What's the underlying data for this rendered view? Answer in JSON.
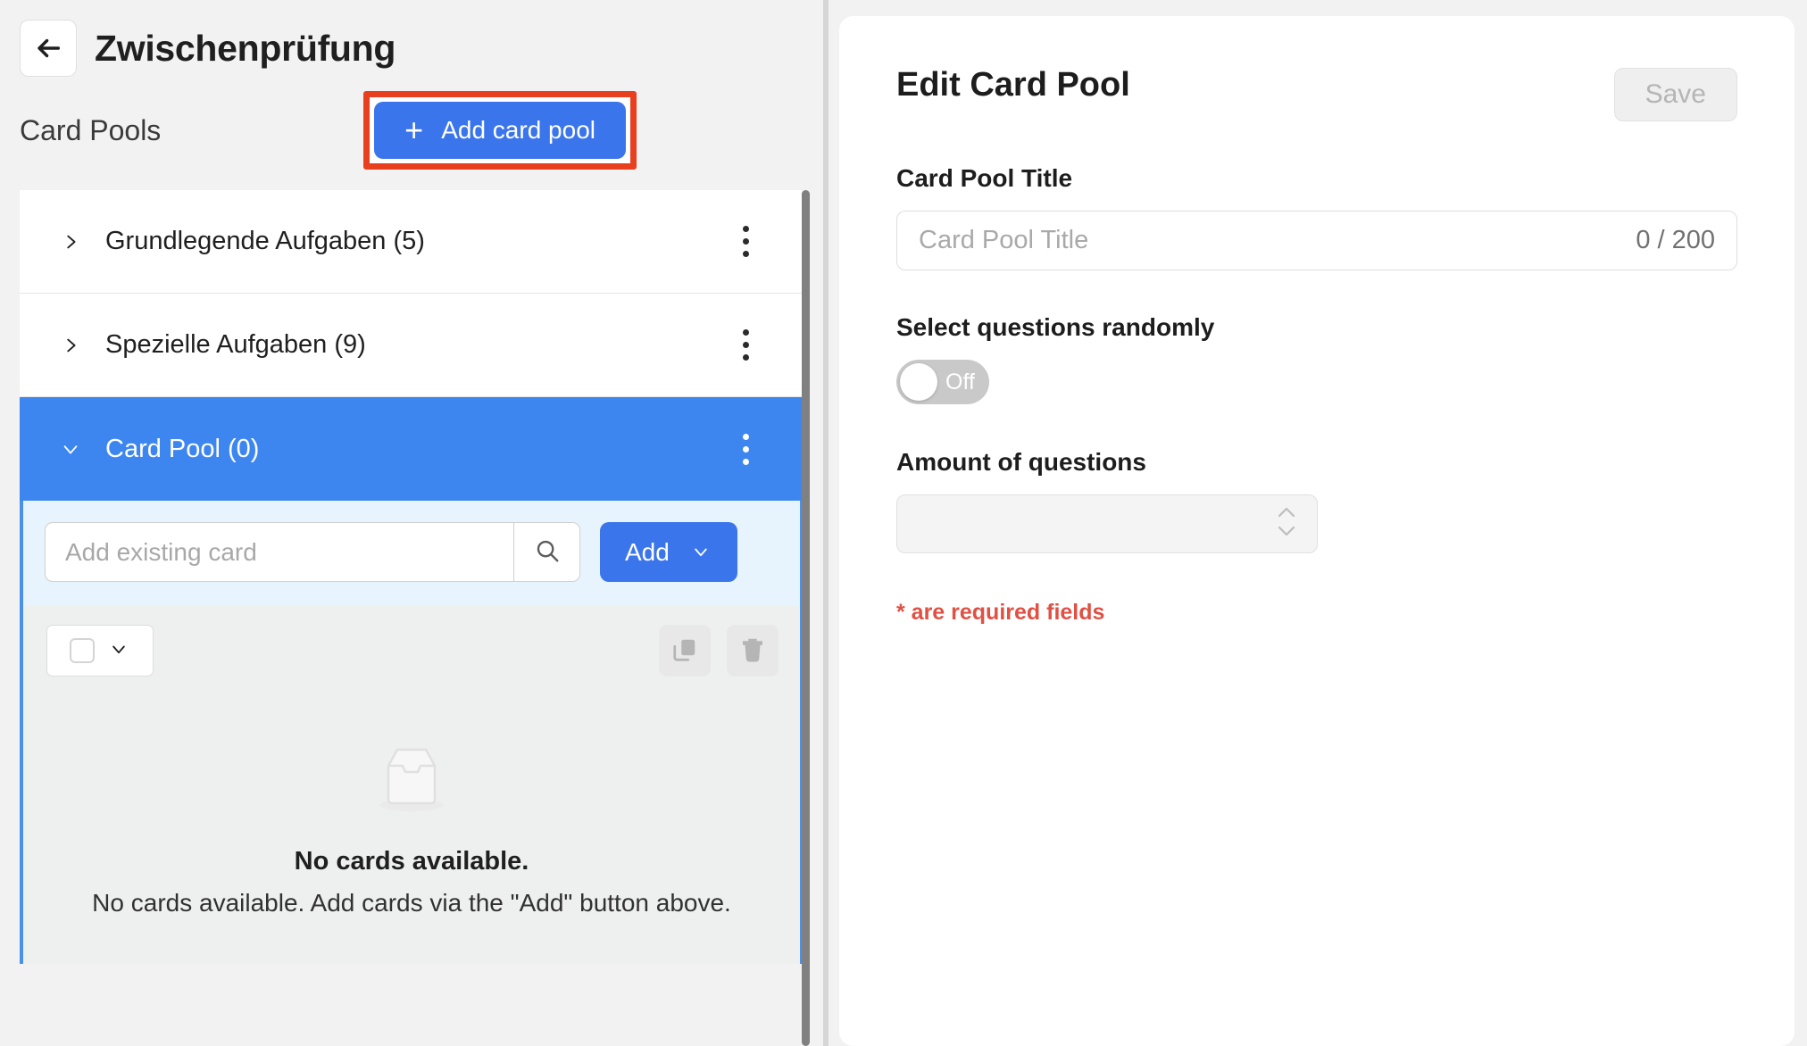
{
  "header": {
    "back_icon": "arrow-left-icon",
    "title": "Zwischenprüfung",
    "section_label": "Card Pools",
    "add_pool_label": "Add card pool",
    "add_pool_plus": "+"
  },
  "colors": {
    "accent_blue": "#3b75ec",
    "selected_row_blue": "#3d86f0",
    "expanded_border_blue": "#4a90e8",
    "search_zone_blue": "#e7f3fd",
    "highlight_red": "#e8401f",
    "required_red": "#e05043",
    "page_bg": "#f2f2f2",
    "scrollbar_grey": "#808080"
  },
  "pool_list": {
    "items": [
      {
        "name": "Grundlegende Aufgaben (5)",
        "expanded": false,
        "selected": false,
        "chevron": "chevron-right-icon"
      },
      {
        "name": "Spezielle Aufgaben (9)",
        "expanded": false,
        "selected": false,
        "chevron": "chevron-right-icon"
      },
      {
        "name": "Card Pool (0)",
        "expanded": true,
        "selected": true,
        "chevron": "chevron-down-icon"
      }
    ]
  },
  "expanded_panel": {
    "search_placeholder": "Add existing card",
    "search_value": "",
    "search_icon": "magnifier-icon",
    "add_button_label": "Add",
    "add_button_chevron": "chevron-down-icon",
    "select_all_checkbox": "checkbox-unchecked-icon",
    "select_all_chevron": "chevron-down-icon",
    "duplicate_icon": "copy-icon",
    "delete_icon": "trash-icon",
    "empty_icon": "empty-inbox-icon",
    "empty_title": "No cards available.",
    "empty_description": "No cards available. Add cards via the \"Add\" button above."
  },
  "edit_panel": {
    "title": "Edit Card Pool",
    "save_label": "Save",
    "card_pool_title_label": "Card Pool Title",
    "card_pool_title_placeholder": "Card Pool Title",
    "card_pool_title_value": "",
    "char_counter": "0 / 200",
    "random_label": "Select questions randomly",
    "toggle_state": "Off",
    "amount_label": "Amount of questions",
    "amount_value": "",
    "spinner_up_icon": "chevron-up-icon",
    "spinner_down_icon": "chevron-down-icon",
    "required_note": "* are required fields"
  }
}
